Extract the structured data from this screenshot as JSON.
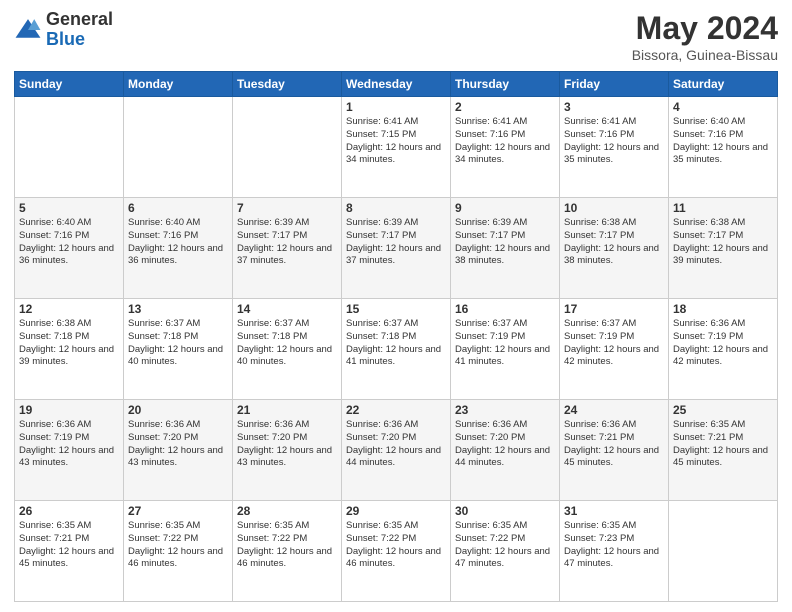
{
  "header": {
    "logo_general": "General",
    "logo_blue": "Blue",
    "title": "May 2024",
    "subtitle": "Bissora, Guinea-Bissau"
  },
  "days_of_week": [
    "Sunday",
    "Monday",
    "Tuesday",
    "Wednesday",
    "Thursday",
    "Friday",
    "Saturday"
  ],
  "weeks": [
    [
      {
        "day": "",
        "info": ""
      },
      {
        "day": "",
        "info": ""
      },
      {
        "day": "",
        "info": ""
      },
      {
        "day": "1",
        "info": "Sunrise: 6:41 AM\nSunset: 7:15 PM\nDaylight: 12 hours and 34 minutes."
      },
      {
        "day": "2",
        "info": "Sunrise: 6:41 AM\nSunset: 7:16 PM\nDaylight: 12 hours and 34 minutes."
      },
      {
        "day": "3",
        "info": "Sunrise: 6:41 AM\nSunset: 7:16 PM\nDaylight: 12 hours and 35 minutes."
      },
      {
        "day": "4",
        "info": "Sunrise: 6:40 AM\nSunset: 7:16 PM\nDaylight: 12 hours and 35 minutes."
      }
    ],
    [
      {
        "day": "5",
        "info": "Sunrise: 6:40 AM\nSunset: 7:16 PM\nDaylight: 12 hours and 36 minutes."
      },
      {
        "day": "6",
        "info": "Sunrise: 6:40 AM\nSunset: 7:16 PM\nDaylight: 12 hours and 36 minutes."
      },
      {
        "day": "7",
        "info": "Sunrise: 6:39 AM\nSunset: 7:17 PM\nDaylight: 12 hours and 37 minutes."
      },
      {
        "day": "8",
        "info": "Sunrise: 6:39 AM\nSunset: 7:17 PM\nDaylight: 12 hours and 37 minutes."
      },
      {
        "day": "9",
        "info": "Sunrise: 6:39 AM\nSunset: 7:17 PM\nDaylight: 12 hours and 38 minutes."
      },
      {
        "day": "10",
        "info": "Sunrise: 6:38 AM\nSunset: 7:17 PM\nDaylight: 12 hours and 38 minutes."
      },
      {
        "day": "11",
        "info": "Sunrise: 6:38 AM\nSunset: 7:17 PM\nDaylight: 12 hours and 39 minutes."
      }
    ],
    [
      {
        "day": "12",
        "info": "Sunrise: 6:38 AM\nSunset: 7:18 PM\nDaylight: 12 hours and 39 minutes."
      },
      {
        "day": "13",
        "info": "Sunrise: 6:37 AM\nSunset: 7:18 PM\nDaylight: 12 hours and 40 minutes."
      },
      {
        "day": "14",
        "info": "Sunrise: 6:37 AM\nSunset: 7:18 PM\nDaylight: 12 hours and 40 minutes."
      },
      {
        "day": "15",
        "info": "Sunrise: 6:37 AM\nSunset: 7:18 PM\nDaylight: 12 hours and 41 minutes."
      },
      {
        "day": "16",
        "info": "Sunrise: 6:37 AM\nSunset: 7:19 PM\nDaylight: 12 hours and 41 minutes."
      },
      {
        "day": "17",
        "info": "Sunrise: 6:37 AM\nSunset: 7:19 PM\nDaylight: 12 hours and 42 minutes."
      },
      {
        "day": "18",
        "info": "Sunrise: 6:36 AM\nSunset: 7:19 PM\nDaylight: 12 hours and 42 minutes."
      }
    ],
    [
      {
        "day": "19",
        "info": "Sunrise: 6:36 AM\nSunset: 7:19 PM\nDaylight: 12 hours and 43 minutes."
      },
      {
        "day": "20",
        "info": "Sunrise: 6:36 AM\nSunset: 7:20 PM\nDaylight: 12 hours and 43 minutes."
      },
      {
        "day": "21",
        "info": "Sunrise: 6:36 AM\nSunset: 7:20 PM\nDaylight: 12 hours and 43 minutes."
      },
      {
        "day": "22",
        "info": "Sunrise: 6:36 AM\nSunset: 7:20 PM\nDaylight: 12 hours and 44 minutes."
      },
      {
        "day": "23",
        "info": "Sunrise: 6:36 AM\nSunset: 7:20 PM\nDaylight: 12 hours and 44 minutes."
      },
      {
        "day": "24",
        "info": "Sunrise: 6:36 AM\nSunset: 7:21 PM\nDaylight: 12 hours and 45 minutes."
      },
      {
        "day": "25",
        "info": "Sunrise: 6:35 AM\nSunset: 7:21 PM\nDaylight: 12 hours and 45 minutes."
      }
    ],
    [
      {
        "day": "26",
        "info": "Sunrise: 6:35 AM\nSunset: 7:21 PM\nDaylight: 12 hours and 45 minutes."
      },
      {
        "day": "27",
        "info": "Sunrise: 6:35 AM\nSunset: 7:22 PM\nDaylight: 12 hours and 46 minutes."
      },
      {
        "day": "28",
        "info": "Sunrise: 6:35 AM\nSunset: 7:22 PM\nDaylight: 12 hours and 46 minutes."
      },
      {
        "day": "29",
        "info": "Sunrise: 6:35 AM\nSunset: 7:22 PM\nDaylight: 12 hours and 46 minutes."
      },
      {
        "day": "30",
        "info": "Sunrise: 6:35 AM\nSunset: 7:22 PM\nDaylight: 12 hours and 47 minutes."
      },
      {
        "day": "31",
        "info": "Sunrise: 6:35 AM\nSunset: 7:23 PM\nDaylight: 12 hours and 47 minutes."
      },
      {
        "day": "",
        "info": ""
      }
    ]
  ]
}
